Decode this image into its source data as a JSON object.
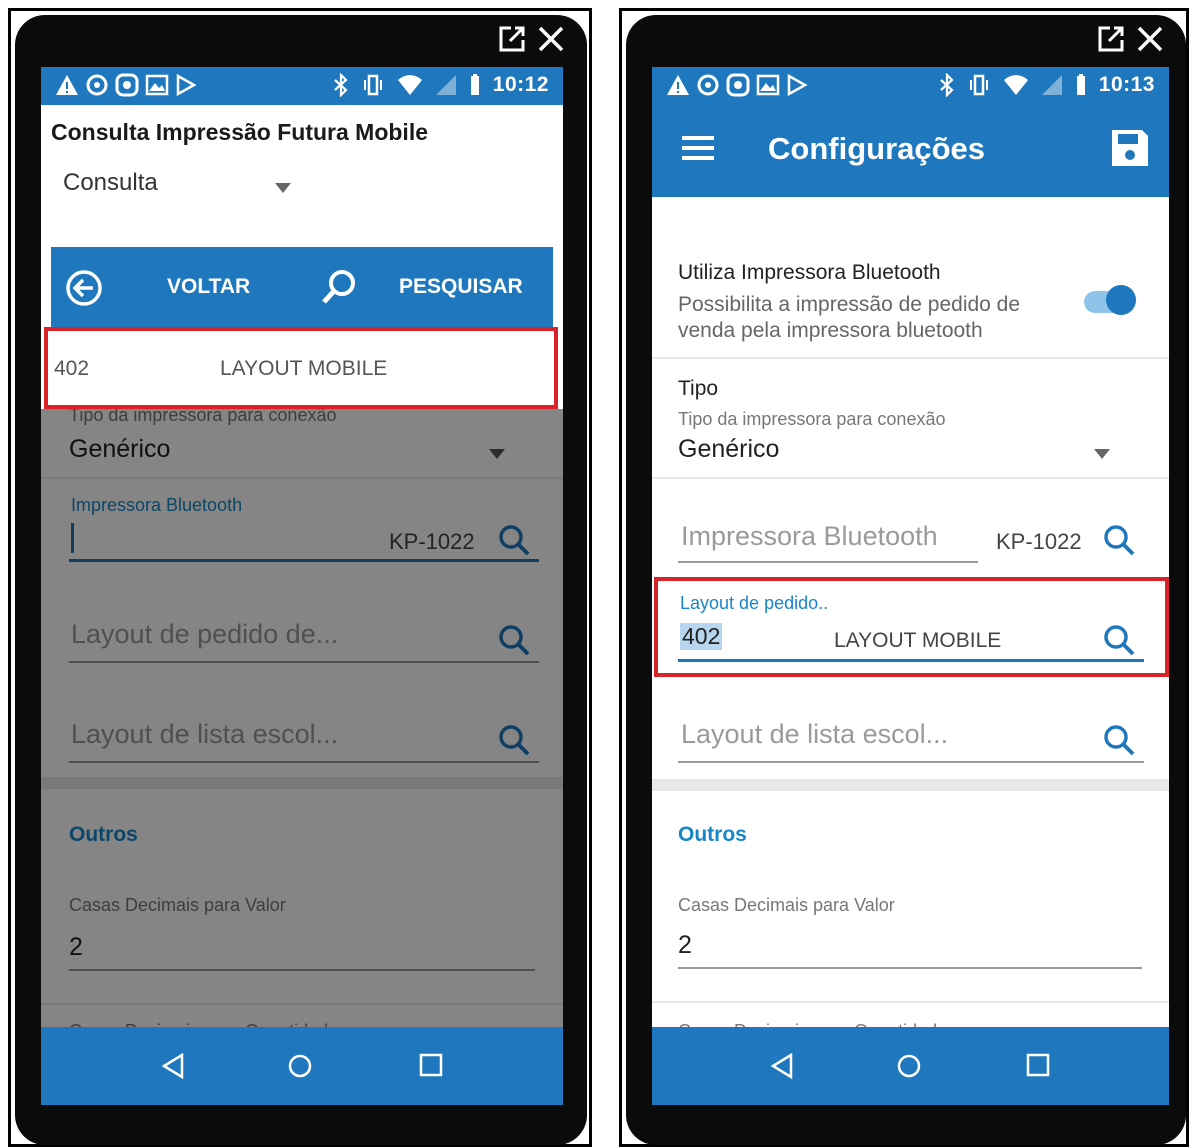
{
  "window_icons": [
    "popout-icon",
    "close-icon"
  ],
  "colors": {
    "primary_blue": "#1f78be",
    "accent_blue": "#1787c9",
    "highlight_red": "#d8232a",
    "dim_overlay": "rgba(0,0,0,0.48)"
  },
  "left_phone": {
    "status_time": "10:12",
    "dialog_title": "Consulta Impressão Futura Mobile",
    "consulta_select": "Consulta",
    "toolbar": {
      "back_label": "VOLTAR",
      "search_label": "PESQUISAR"
    },
    "result": {
      "code": "402",
      "description": "LAYOUT MOBILE"
    },
    "background_form": {
      "tipo_helper": "Tipo da impressora para conexão",
      "tipo_value": "Genérico",
      "bluetooth_label": "Impressora Bluetooth",
      "bluetooth_value": "KP-1022",
      "layout_pedido_hint": "Layout de pedido de...",
      "layout_lista_hint": "Layout de lista escol...",
      "outros_title": "Outros",
      "casas_valor_label": "Casas Decimais para Valor",
      "casas_valor_value": "2",
      "casas_qtd_label": "Casas Decimais para Quantidade"
    }
  },
  "right_phone": {
    "status_time": "10:13",
    "appbar_title": "Configurações",
    "bluetooth_toggle": {
      "title": "Utiliza Impressora Bluetooth",
      "desc_line1": "Possibilita a impressão de pedido de",
      "desc_line2": "venda pela impressora bluetooth",
      "enabled": true
    },
    "tipo": {
      "title": "Tipo",
      "helper": "Tipo da impressora para conexão",
      "value": "Genérico"
    },
    "impressora_bluetooth": {
      "hint": "Impressora Bluetooth",
      "value": "KP-1022"
    },
    "layout_pedido": {
      "label": "Layout de pedido..",
      "code": "402",
      "description": "LAYOUT MOBILE"
    },
    "layout_lista_hint": "Layout de lista escol...",
    "outros_title": "Outros",
    "casas_valor_label": "Casas Decimais para Valor",
    "casas_valor_value": "2",
    "casas_qtd_label": "Casas Decimais para Quantidade"
  }
}
